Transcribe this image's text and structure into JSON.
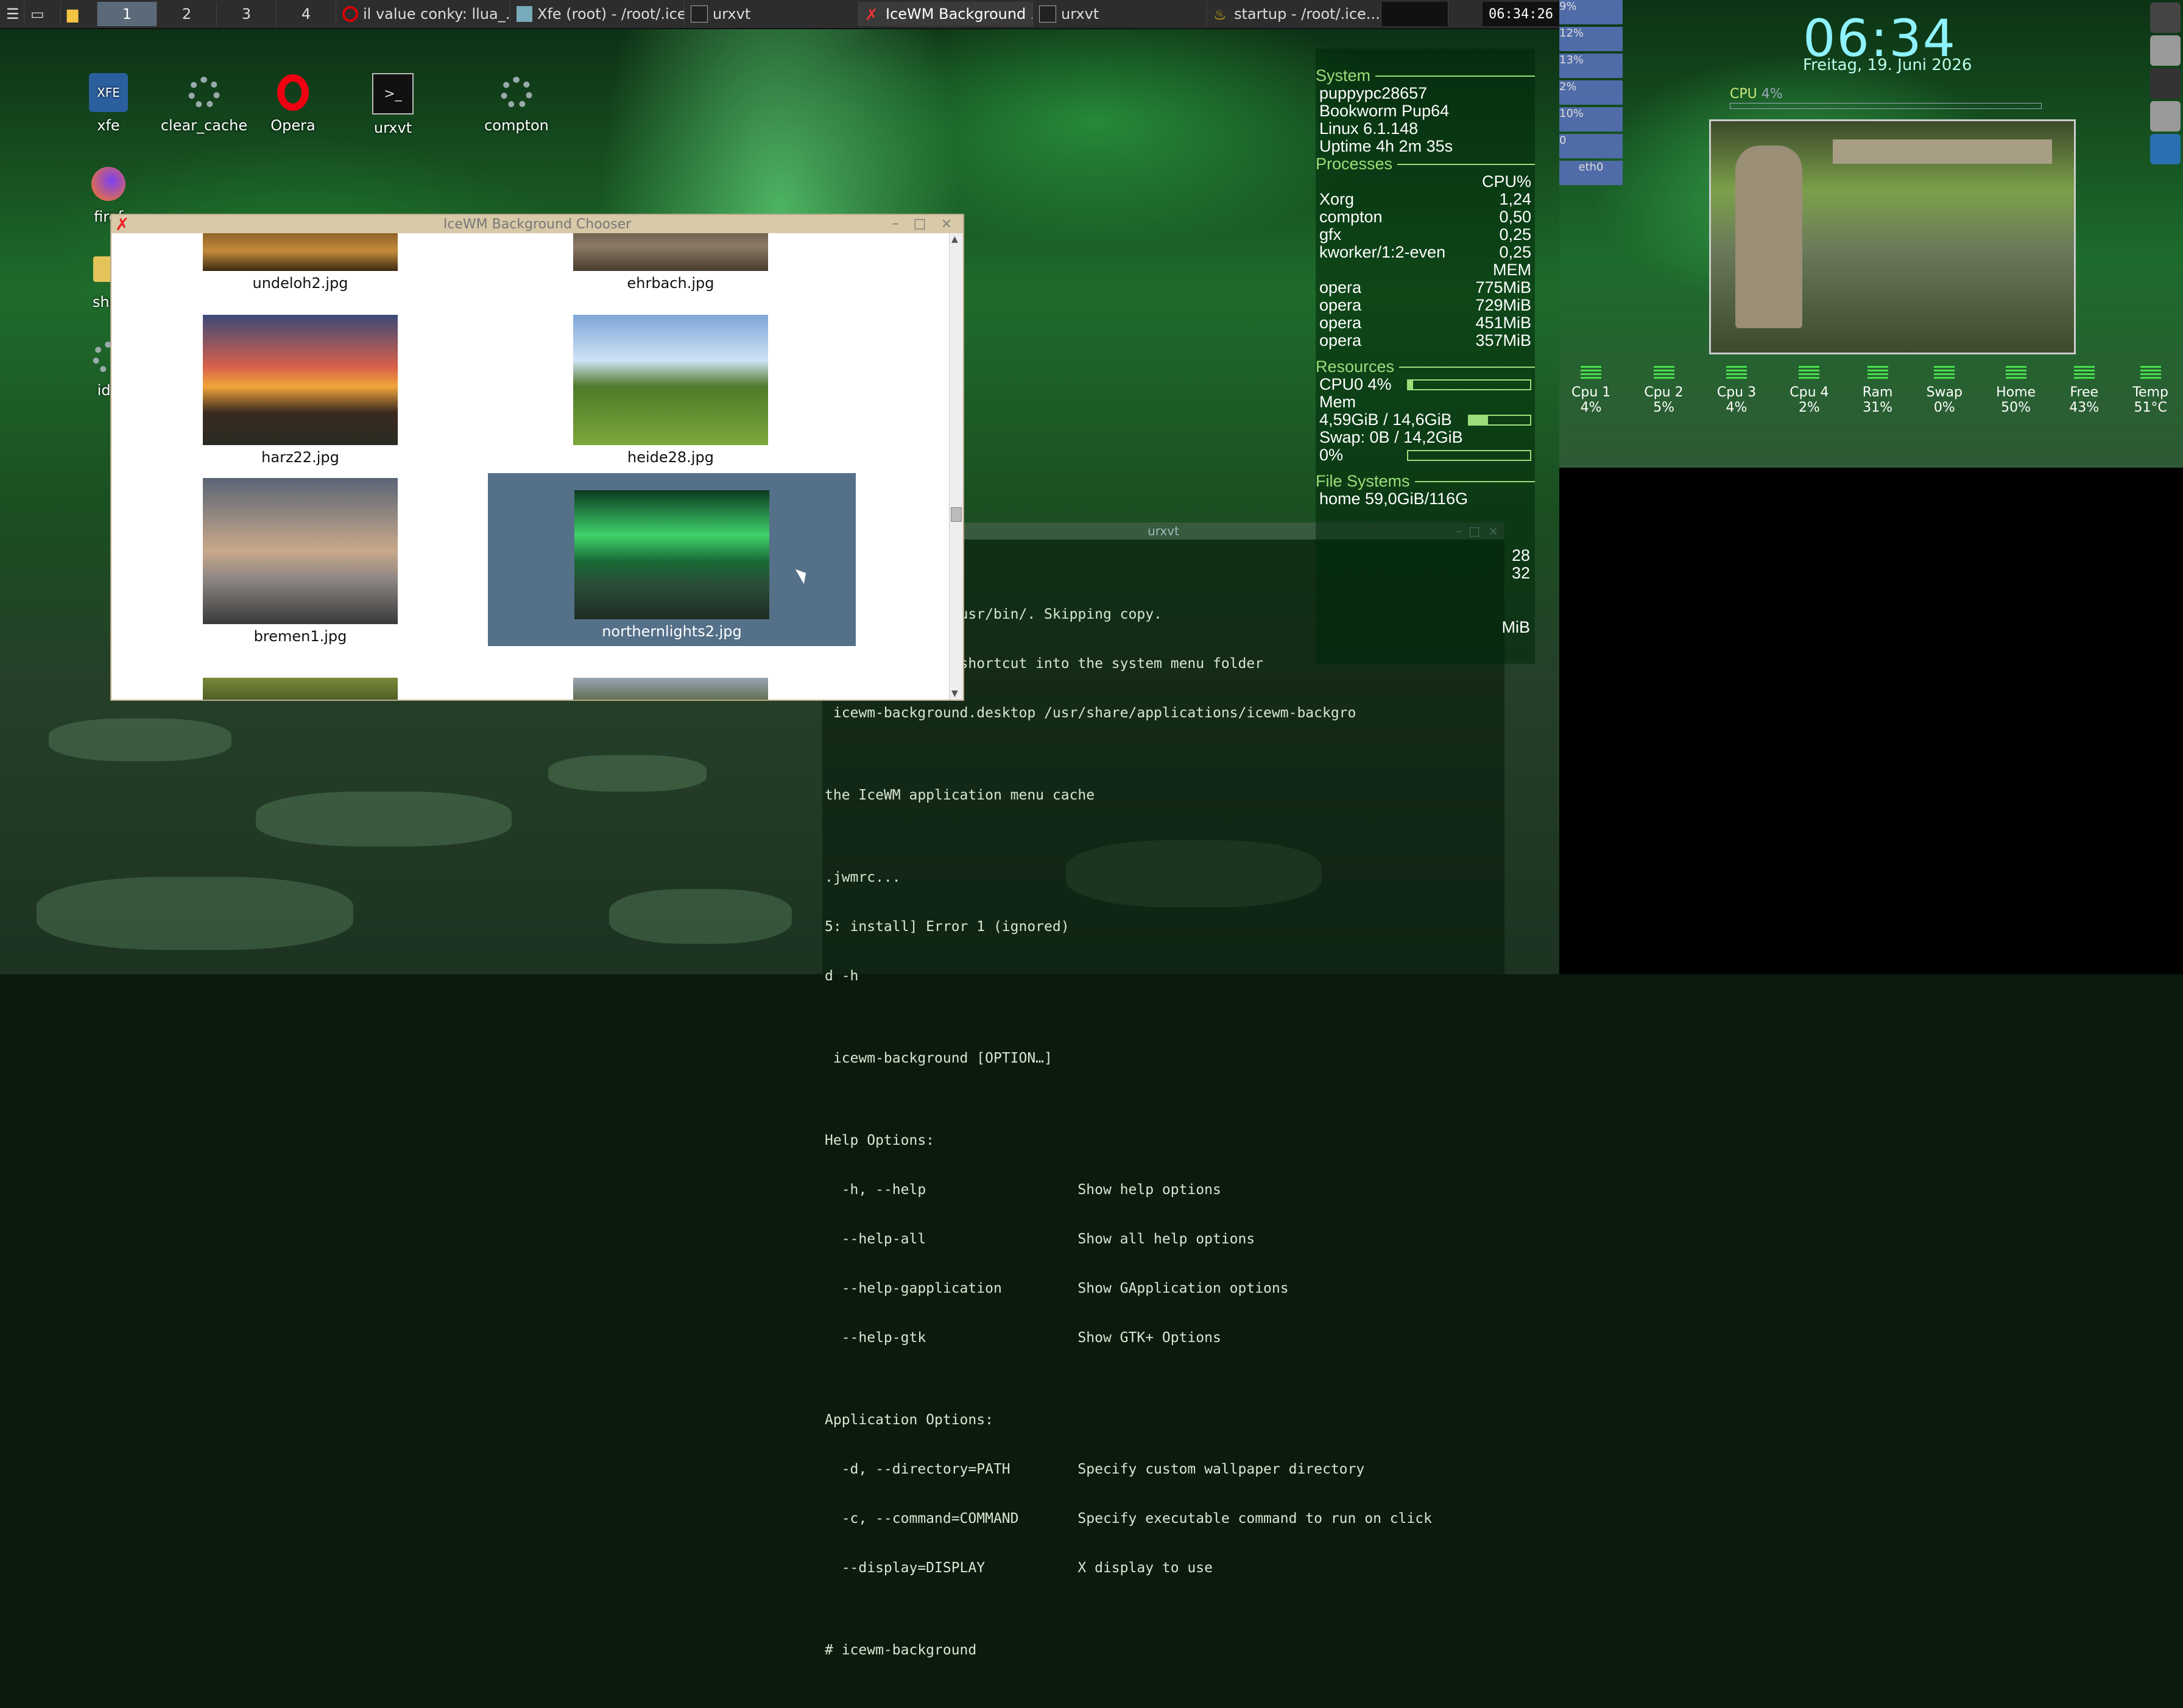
{
  "taskbar": {
    "workspaces": [
      "1",
      "2",
      "3",
      "4"
    ],
    "tasks": [
      {
        "label": "il value conky: llua_...",
        "icon": "opera-icon"
      },
      {
        "label": "Xfe (root) - /root/.ice...",
        "icon": "xfe-icon"
      },
      {
        "label": "urxvt",
        "icon": "terminal-icon"
      },
      {
        "label": "IceWM Background ...",
        "icon": "icewm-icon"
      },
      {
        "label": "urxvt",
        "icon": "terminal-icon"
      },
      {
        "label": "startup - /root/.ice...",
        "icon": "genie-icon"
      }
    ],
    "clock": "06:34:26"
  },
  "desktop_icons": [
    {
      "label": "xfe"
    },
    {
      "label": "clear_cache"
    },
    {
      "label": "Opera"
    },
    {
      "label": "urxvt"
    },
    {
      "label": "compton"
    },
    {
      "label": "firef"
    },
    {
      "label": "shor"
    },
    {
      "label": "ide"
    }
  ],
  "chooser": {
    "title": "IceWM Background Chooser",
    "items": [
      {
        "file": "undeloh2.jpg"
      },
      {
        "file": "ehrbach.jpg"
      },
      {
        "file": "harz22.jpg"
      },
      {
        "file": "heide28.jpg"
      },
      {
        "file": "bremen1.jpg"
      },
      {
        "file": "northernlights2.jpg"
      }
    ]
  },
  "terminal": {
    "title": "urxvt",
    "lines": [
      "ady present in /usr/bin/. Skipping copy.",
      "e desktop entry shortcut into the system menu folder",
      " icewm-background.desktop /usr/share/applications/icewm-backgro",
      "",
      "the IceWM application menu cache",
      "",
      ".jwmrc...",
      "5: install] Error 1 (ignored)",
      "d -h",
      "",
      " icewm-background [OPTION…]",
      "",
      "Help Options:",
      "  -h, --help                  Show help options",
      "  --help-all                  Show all help options",
      "  --help-gapplication         Show GApplication options",
      "  --help-gtk                  Show GTK+ Options",
      "",
      "Application Options:",
      "  -d, --directory=PATH        Specify custom wallpaper directory",
      "  -c, --command=COMMAND       Specify executable command to run on click",
      "  --display=DISPLAY           X display to use",
      "",
      "# icewm-background"
    ]
  },
  "conky": {
    "system_header": "System",
    "hostname": "puppypc28657",
    "distro": "Bookworm Pup64",
    "kernel": "Linux 6.1.148",
    "uptime": "Uptime 4h 2m 35s",
    "processes_header": "Processes",
    "cpu_col": "CPU%",
    "mem_col": "MEM",
    "cpu_procs": [
      {
        "name": "Xorg",
        "value": "1,24"
      },
      {
        "name": "compton",
        "value": "0,50"
      },
      {
        "name": "gfx",
        "value": "0,25"
      },
      {
        "name": "kworker/1:2-even",
        "value": "0,25"
      }
    ],
    "mem_procs": [
      {
        "name": "opera",
        "value": "775MiB"
      },
      {
        "name": "opera",
        "value": "729MiB"
      },
      {
        "name": "opera",
        "value": "451MiB"
      },
      {
        "name": "opera",
        "value": "357MiB"
      }
    ],
    "resources_header": "Resources",
    "cpu0": "CPU0 4%",
    "cpu0_frac": 0.04,
    "mem_label": "Mem",
    "mem_value": "4,59GiB / 14,6GiB",
    "mem_frac": 0.31,
    "swap": "Swap: 0B / 14,2GiB",
    "swap_pct": "0%",
    "swap_frac": 0,
    "fs_header": "File Systems",
    "fs_home": "home 59,0GiB/116G",
    "side_values": [
      "28",
      "32",
      "MiB"
    ]
  },
  "widget": {
    "time": "06:34",
    "date": "Freitag, 19. Juni 2026",
    "cpu_label": "CPU",
    "cpu_value": "4%",
    "meters": [
      {
        "name": "Cpu 1",
        "value": "4%",
        "level": 0.04
      },
      {
        "name": "Cpu 2",
        "value": "5%",
        "level": 0.05
      },
      {
        "name": "Cpu 3",
        "value": "4%",
        "level": 0.04
      },
      {
        "name": "Cpu 4",
        "value": "2%",
        "level": 0.02
      },
      {
        "name": "Ram",
        "value": "31%",
        "level": 0.31
      },
      {
        "name": "Swap",
        "value": "0%",
        "level": 0
      },
      {
        "name": "Home",
        "value": "50%",
        "level": 0.5
      },
      {
        "name": "Free",
        "value": "43%",
        "level": 0.43
      },
      {
        "name": "Temp",
        "value": "51°C",
        "level": 0.51
      }
    ]
  },
  "graphs": [
    "9%",
    "12%",
    "13%",
    "2%",
    "10%",
    "0",
    "eth0"
  ],
  "colors": {
    "accent": "#9adf7a",
    "selection": "#557089",
    "clock": "#8ef2ff"
  }
}
